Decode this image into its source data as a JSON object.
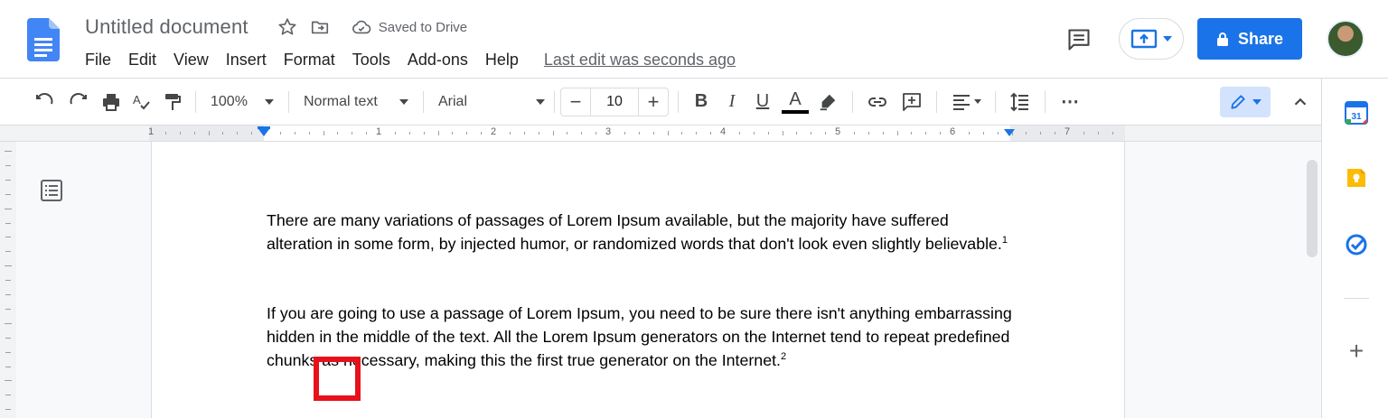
{
  "header": {
    "title": "Untitled document",
    "saved_status": "Saved to Drive",
    "menu": [
      "File",
      "Edit",
      "View",
      "Insert",
      "Format",
      "Tools",
      "Add-ons",
      "Help"
    ],
    "last_edit": "Last edit was seconds ago",
    "share_label": "Share"
  },
  "toolbar": {
    "zoom": "100%",
    "style": "Normal text",
    "font": "Arial",
    "font_size": "10",
    "minus": "−",
    "plus": "+",
    "bold": "B",
    "italic": "I",
    "underline": "U",
    "text_color": "A",
    "more": "⋯"
  },
  "ruler": {
    "numbers": [
      "1",
      "1",
      "2",
      "3",
      "4",
      "5",
      "6",
      "7"
    ]
  },
  "document": {
    "paragraph1": "There are many variations of passages of Lorem Ipsum available, but the majority have suffered alteration in some form, by injected humor, or randomized words that don't look even slightly believable.",
    "footnote1": "1",
    "paragraph2": "If you are going to use a passage of Lorem Ipsum, you need to be sure there isn't anything embarrassing hidden in the middle of the text. All the Lorem Ipsum generators on the Internet tend to repeat predefined chunks as necessary, making this the first true generator on the Internet.",
    "footnote2": "2"
  },
  "side_panel": {
    "calendar_day": "31",
    "add": "+"
  },
  "colors": {
    "accent": "#1a73e8",
    "highlight": "#e8111b",
    "keep": "#fbbc04"
  }
}
